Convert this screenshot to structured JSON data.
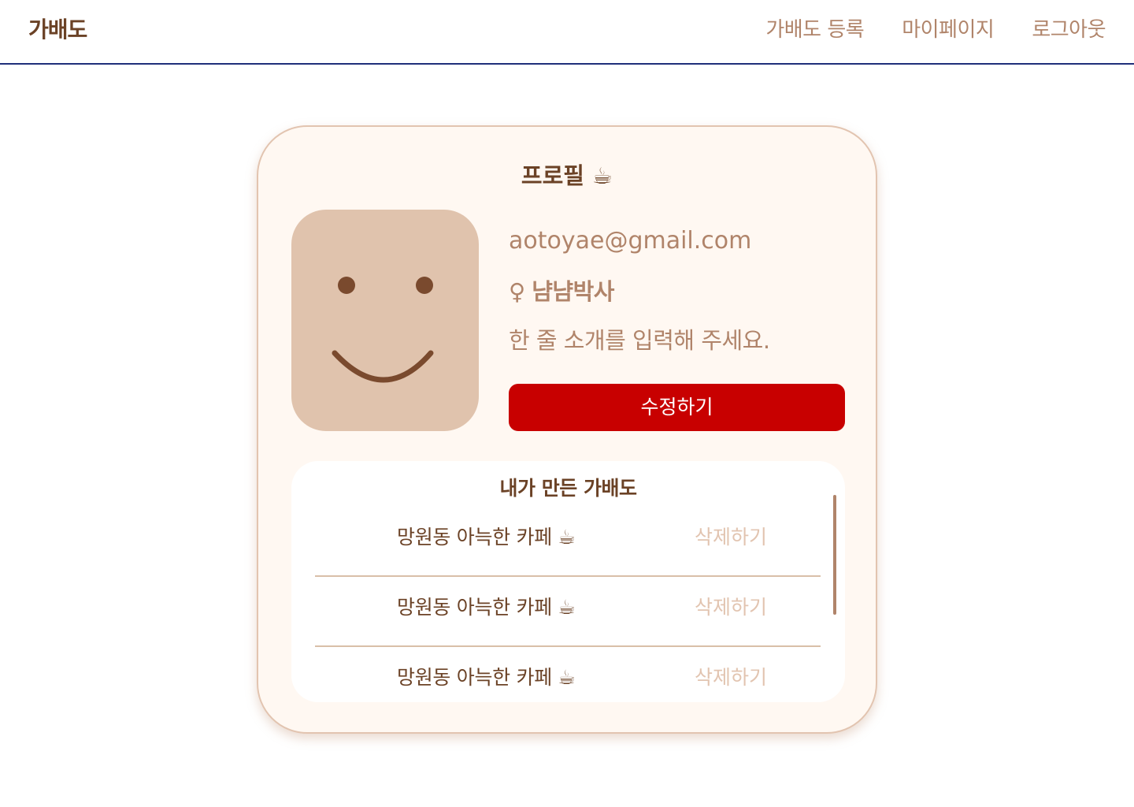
{
  "header": {
    "logo": "가배도",
    "nav": {
      "register": "가배도 등록",
      "mypage": "마이페이지",
      "logout": "로그아웃"
    }
  },
  "profile": {
    "title": "프로필 ☕",
    "email": "aotoyae@gmail.com",
    "gender_symbol": "♀",
    "nickname": "냠냠박사",
    "intro": "한 줄 소개를 입력해 주세요.",
    "edit_label": "수정하기"
  },
  "my_list": {
    "title": "내가 만든 가배도",
    "items": [
      {
        "title": "망원동 아늑한 카페 ☕",
        "delete_label": "삭제하기"
      },
      {
        "title": "망원동 아늑한 카페 ☕",
        "delete_label": "삭제하기"
      },
      {
        "title": "망원동 아늑한 카페 ☕",
        "delete_label": "삭제하기"
      }
    ]
  },
  "colors": {
    "brand_brown": "#6b4226",
    "light_brown": "#b0846a",
    "accent_red": "#c80000",
    "card_bg": "#fff8f2",
    "avatar_bg": "#e0c3ad",
    "header_border": "#1f2f7a"
  },
  "icons": {
    "avatar": "smiley-face-icon"
  }
}
